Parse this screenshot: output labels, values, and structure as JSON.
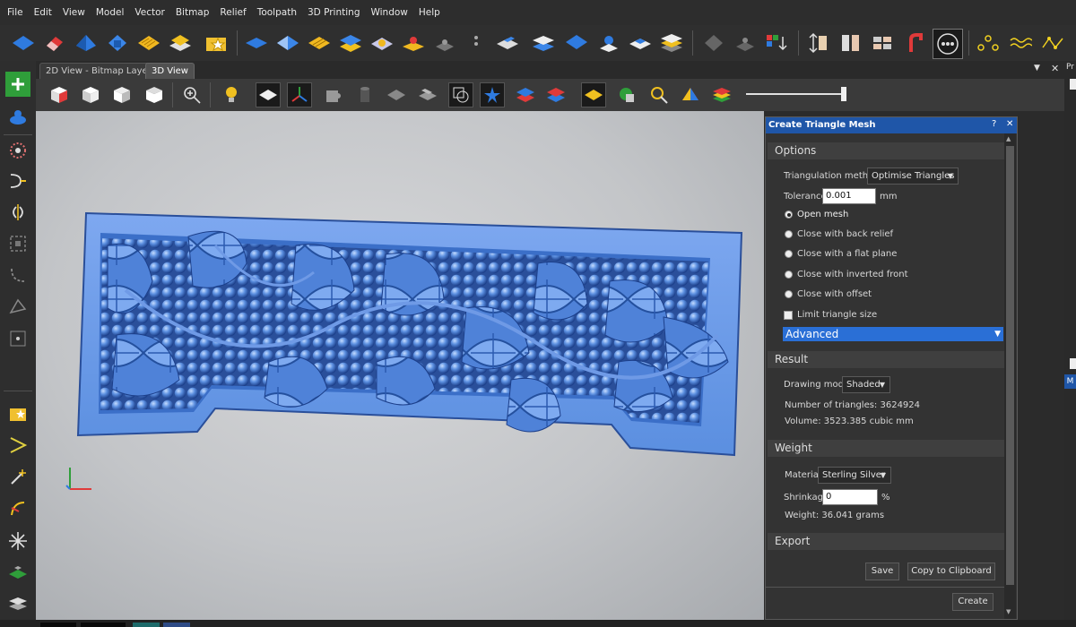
{
  "menu": [
    "File",
    "Edit",
    "View",
    "Model",
    "Vector",
    "Bitmap",
    "Relief",
    "Toolpath",
    "3D Printing",
    "Window",
    "Help"
  ],
  "tabs": {
    "bitmap": "2D View - Bitmap Layer",
    "view3d": "3D View"
  },
  "panel": {
    "title": "Create Triangle Mesh",
    "help": "?",
    "close": "✕",
    "options": {
      "heading": "Options",
      "triangulation_label": "Triangulation method",
      "triangulation_value": "Optimise Triangles",
      "tolerance_label": "Tolerance",
      "tolerance_value": "0.001",
      "tolerance_unit": "mm",
      "radios": [
        "Open mesh",
        "Close with back relief",
        "Close with a flat plane",
        "Close with inverted front",
        "Close with offset"
      ],
      "limit_label": "Limit triangle size"
    },
    "advanced": "Advanced",
    "result": {
      "heading": "Result",
      "drawing_mode_label": "Drawing mode",
      "drawing_mode_value": "Shaded",
      "triangles": "Number of triangles: 3624924",
      "volume": "Volume: 3523.385 cubic mm"
    },
    "weight": {
      "heading": "Weight",
      "material_label": "Material",
      "material_value": "Sterling Silver",
      "shrinkage_label": "Shrinkage",
      "shrinkage_value": "0",
      "shrinkage_unit": "%",
      "weight_text": "Weight: 36.041 grams"
    },
    "export": {
      "heading": "Export",
      "save": "Save",
      "copy": "Copy to Clipboard"
    },
    "create": "Create"
  },
  "right_edge": {
    "top": "Pr",
    "mid": "M"
  },
  "colors": {
    "panel_title": "#1f56a8",
    "relief_blue": "#5b8fe0",
    "accent": "#2a6fd6"
  }
}
